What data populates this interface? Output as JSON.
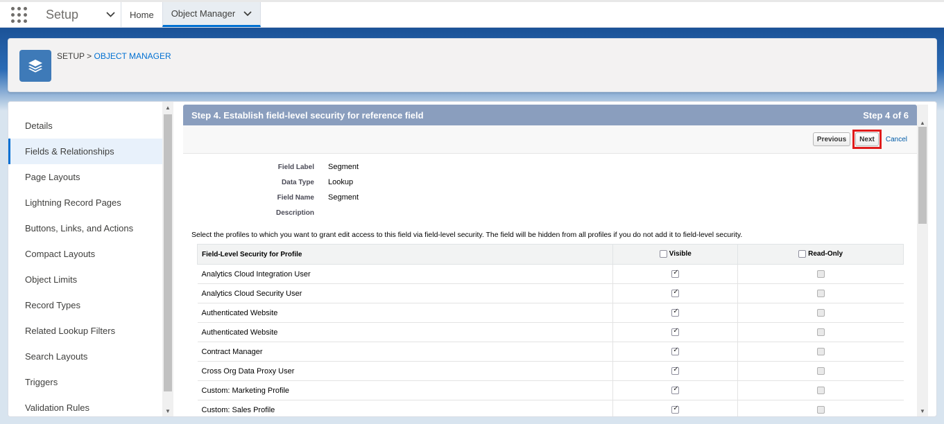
{
  "topnav": {
    "app_name": "Setup",
    "tabs": [
      {
        "label": "Home"
      },
      {
        "label": "Object Manager"
      }
    ]
  },
  "header": {
    "breadcrumb_setup": "SETUP",
    "breadcrumb_sep": ">",
    "breadcrumb_object_manager": "OBJECT MANAGER"
  },
  "sidebar": {
    "items": [
      {
        "label": "Details"
      },
      {
        "label": "Fields & Relationships"
      },
      {
        "label": "Page Layouts"
      },
      {
        "label": "Lightning Record Pages"
      },
      {
        "label": "Buttons, Links, and Actions"
      },
      {
        "label": "Compact Layouts"
      },
      {
        "label": "Object Limits"
      },
      {
        "label": "Record Types"
      },
      {
        "label": "Related Lookup Filters"
      },
      {
        "label": "Search Layouts"
      },
      {
        "label": "Triggers"
      },
      {
        "label": "Validation Rules"
      }
    ]
  },
  "step": {
    "title": "Step 4. Establish field-level security for reference field",
    "step_of": "Step 4 of 6",
    "previous_label": "Previous",
    "next_label": "Next",
    "cancel_label": "Cancel"
  },
  "field_info": {
    "rows": [
      {
        "label": "Field Label",
        "value": "Segment"
      },
      {
        "label": "Data Type",
        "value": "Lookup"
      },
      {
        "label": "Field Name",
        "value": "Segment"
      },
      {
        "label": "Description",
        "value": ""
      }
    ]
  },
  "instructions": "Select the profiles to which you want to grant edit access to this field via field-level security. The field will be hidden from all profiles if you do not add it to field-level security.",
  "table": {
    "headers": {
      "profile": "Field-Level Security for Profile",
      "visible": "Visible",
      "read_only": "Read-Only"
    },
    "rows": [
      {
        "profile": "Analytics Cloud Integration User",
        "visible": true,
        "read_only": false
      },
      {
        "profile": "Analytics Cloud Security User",
        "visible": true,
        "read_only": false
      },
      {
        "profile": "Authenticated Website",
        "visible": true,
        "read_only": false
      },
      {
        "profile": "Authenticated Website",
        "visible": true,
        "read_only": false
      },
      {
        "profile": "Contract Manager",
        "visible": true,
        "read_only": false
      },
      {
        "profile": "Cross Org Data Proxy User",
        "visible": true,
        "read_only": false
      },
      {
        "profile": "Custom: Marketing Profile",
        "visible": true,
        "read_only": false
      },
      {
        "profile": "Custom: Sales Profile",
        "visible": true,
        "read_only": false
      }
    ]
  },
  "icons": {
    "app_launcher": "app-launcher-icon",
    "layers": "layers-icon",
    "chevron": "chevron-down-icon"
  },
  "colors": {
    "accent": "#0070d2",
    "step_header": "#8a9ebe",
    "highlight": "#e01b1b"
  }
}
